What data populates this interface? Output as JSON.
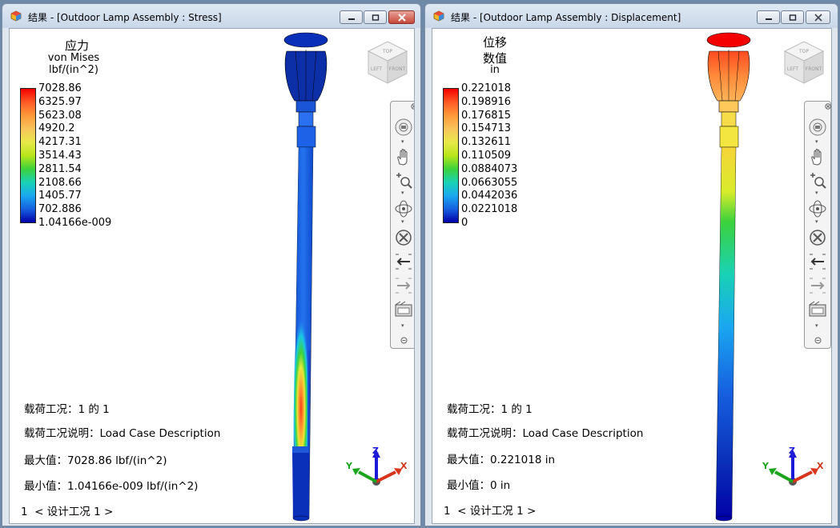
{
  "windows": [
    {
      "title": "结果 - [Outdoor Lamp Assembly : Stress]",
      "result_title": "应力",
      "result_subtitle": "von Mises",
      "units": "lbf/(in^2)",
      "legend": [
        "7028.86",
        "6325.97",
        "5623.08",
        "4920.2",
        "4217.31",
        "3514.43",
        "2811.54",
        "2108.66",
        "1405.77",
        "702.886",
        "1.04166e-009"
      ],
      "load_case_label": "载荷工况：",
      "load_case_value": "1 的 1",
      "load_desc_label": "载荷工况说明：",
      "load_desc_value": "Load Case Description",
      "max_label": "最大值：",
      "max_value": "7028.86 lbf/(in^2)",
      "min_label": "最小值：",
      "min_value": "1.04166e-009 lbf/(in^2)",
      "design_index": "1",
      "design_nav": "< 设计工况  1 >"
    },
    {
      "title": "结果 - [Outdoor Lamp Assembly : Displacement]",
      "result_title": "位移",
      "result_subtitle": "数值",
      "units": "in",
      "legend": [
        "0.221018",
        "0.198916",
        "0.176815",
        "0.154713",
        "0.132611",
        "0.110509",
        "0.0884073",
        "0.0663055",
        "0.0442036",
        "0.0221018",
        "0"
      ],
      "load_case_label": "载荷工况：",
      "load_case_value": "1 的 1",
      "load_desc_label": "载荷工况说明：",
      "load_desc_value": "Load Case Description",
      "max_label": "最大值：",
      "max_value": "0.221018 in",
      "min_label": "最小值：",
      "min_value": "0 in",
      "design_index": "1",
      "design_nav": "< 设计工况  1 >"
    }
  ],
  "viewcube": {
    "top": "TOP",
    "left": "LEFT",
    "front": "FRONT"
  },
  "triad": {
    "x": "X",
    "y": "Y",
    "z": "Z"
  },
  "colors": {
    "scale_max": "#ff0000",
    "scale_min": "#0000a8",
    "x_axis": "#d8351a",
    "y_axis": "#1aa51a",
    "z_axis": "#1a1ad8"
  },
  "icons": [
    "steering-wheel-icon",
    "pan-icon",
    "zoom-icon",
    "orbit-icon",
    "center-icon",
    "look-back-icon",
    "look-forward-icon",
    "show-motion-icon"
  ]
}
